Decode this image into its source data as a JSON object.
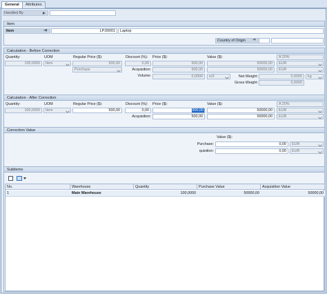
{
  "tabs": {
    "general": "General",
    "attributes": "Attributes"
  },
  "header": {
    "handled_by_label": "Handled By"
  },
  "item": {
    "section": "Item",
    "label": "Item",
    "code": "LP.00001",
    "name": "Laptop",
    "country_label": "Country of Origin"
  },
  "before": {
    "section": "Calculation - Before Correction",
    "quantity_label": "Quantity:",
    "quantity": "100,0000",
    "uom_label": "UOM",
    "uom": "Item",
    "regular_price_label": "Regular Price ($):",
    "regular_price": "500,00",
    "price_type": "Purchase",
    "discount_label": "Discount (%):",
    "discount": "0,00",
    "price_label": "Price ($):",
    "price": "500,00",
    "acquisition_label": "Acquisition:",
    "acq_price": "500,00",
    "value_label": "Value ($):",
    "value": "50000,00",
    "acq_value": "50000,00",
    "vat": "A 20%",
    "cur1": "EUR",
    "cur2": "EUR",
    "volume_label": "Volume:",
    "volume": "0,0000",
    "volume_unit": "m3",
    "net_weight_label": "Net Weight:",
    "net_weight": "0,0000",
    "weight_unit": "kg",
    "gross_weight_label": "Gross Weight:",
    "gross_weight": "0,0000"
  },
  "after": {
    "section": "Calculation - After Correction",
    "quantity_label": "Quantity:",
    "quantity": "100,0000",
    "uom_label": "UOM",
    "uom": "Item",
    "regular_price_label": "Regular Price ($):",
    "regular_price": "500,00",
    "discount_label": "Discount (%):",
    "discount": "0,00",
    "price_label": "Price ($):",
    "price": "500,00",
    "acquisition_label": "Acquisition:",
    "acq_price": "500,00",
    "value_label": "Value ($):",
    "value": "50000,00",
    "acq_value": "50000,00",
    "vat": "A 20%",
    "cur1": "EUR",
    "cur2": "EUR"
  },
  "correction": {
    "section": "Correction Value",
    "value_label": "Value ($):",
    "purchase_label": "Purchase:",
    "purchase": "0,00",
    "acquisition_label": "quisition:",
    "acquisition": "0,00",
    "cur1": "EUR",
    "cur2": "EUR"
  },
  "subitems": {
    "section": "Subitems",
    "columns": [
      "No.",
      "Warehouse",
      "Quantity",
      "Purchase Value",
      "Acquisition Value"
    ],
    "rows": [
      {
        "no": "1",
        "warehouse": "Main Warehouse",
        "quantity": "100,0000",
        "purchase": "50000,00",
        "acquisition": "50000,00"
      }
    ]
  }
}
